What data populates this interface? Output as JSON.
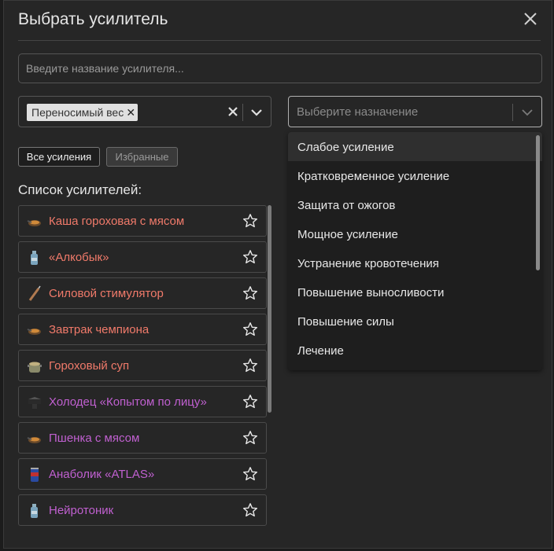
{
  "modal": {
    "title": "Выбрать усилитель",
    "close_icon": "close-icon"
  },
  "search": {
    "placeholder": "Введите название усилителя...",
    "value": ""
  },
  "filter_left": {
    "chip_label": "Переносимый вес",
    "chip_remove_icon": "close-small-icon",
    "clear_icon": "clear-icon",
    "toggle_icon": "chevron-down-icon"
  },
  "filter_right": {
    "placeholder": "Выберите назначение",
    "toggle_icon": "chevron-down-icon"
  },
  "tabs": {
    "all": "Все усиления",
    "favorites": "Избранные"
  },
  "list": {
    "label": "Список усилителей:",
    "items": [
      {
        "label": "Каша гороховая с мясом",
        "icon": "pan-food-icon",
        "color": "#f07a6a"
      },
      {
        "label": "«Алкобык»",
        "icon": "bottle-icon",
        "color": "#f07a6a"
      },
      {
        "label": "Силовой стимулятор",
        "icon": "syringe-icon",
        "color": "#f07a6a"
      },
      {
        "label": "Завтрак чемпиона",
        "icon": "pan-food-icon",
        "color": "#f07a6a"
      },
      {
        "label": "Гороховый суп",
        "icon": "soup-pot-icon",
        "color": "#f07a6a"
      },
      {
        "label": "Холодец «Копытом по лицу»",
        "icon": "dish-icon",
        "color": "#c060d0"
      },
      {
        "label": "Пшенка с мясом",
        "icon": "pan-food-icon",
        "color": "#c060d0"
      },
      {
        "label": "Анаболик «ATLAS»",
        "icon": "can-icon",
        "color": "#c060d0"
      },
      {
        "label": "Нейротоник",
        "icon": "bottle-icon",
        "color": "#c060d0"
      }
    ]
  },
  "dropdown": {
    "options": [
      "Слабое усиление",
      "Кратковременное усиление",
      "Защита от ожогов",
      "Мощное усиление",
      "Устранение кровотечения",
      "Повышение выносливости",
      "Повышение силы",
      "Лечение"
    ],
    "highlighted_index": 0
  },
  "colors": {
    "red_item": "#f07a6a",
    "purple_item": "#c060d0",
    "background": "#262626"
  }
}
